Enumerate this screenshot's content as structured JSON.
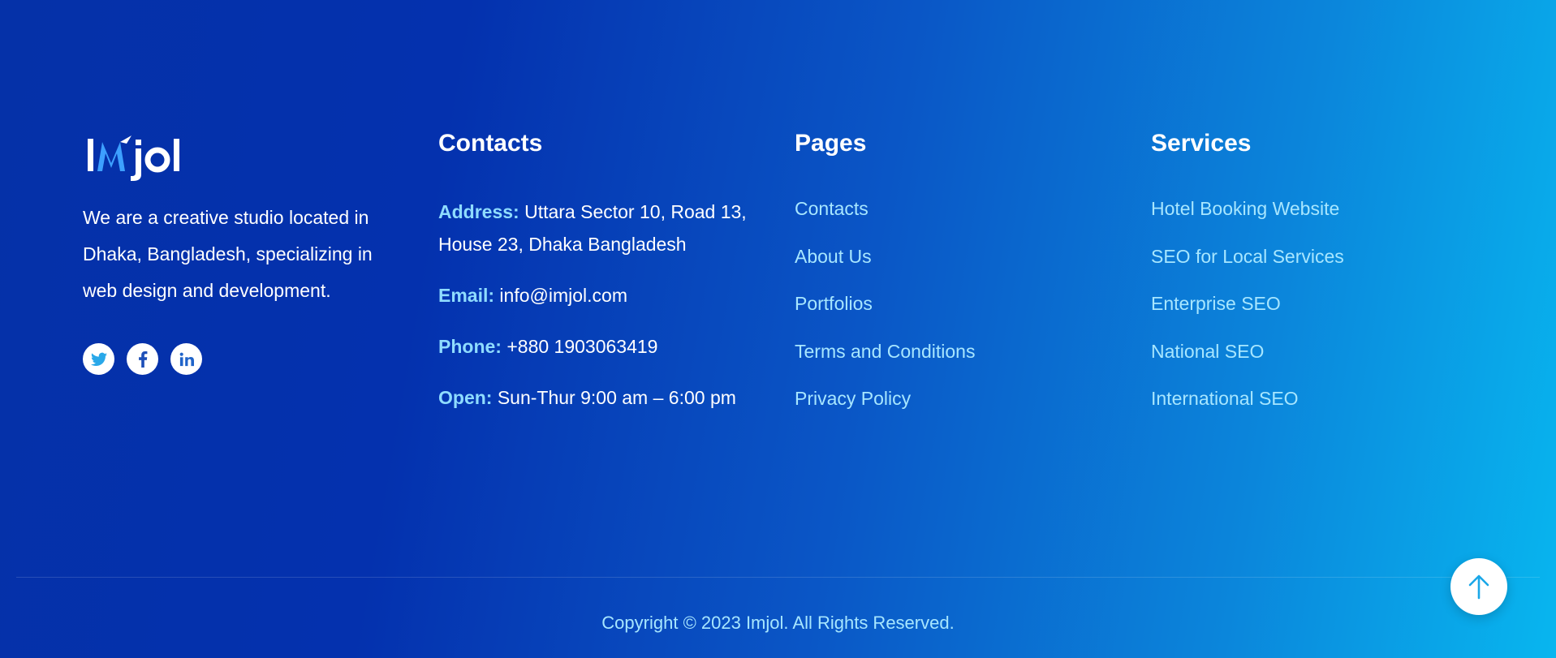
{
  "brand": {
    "logo_text": "Imjol",
    "description": "We are a creative studio located in Dhaka, Bangladesh, specializing in web design and development."
  },
  "social": [
    {
      "icon": "twitter-icon",
      "color": "#29a8e9"
    },
    {
      "icon": "facebook-icon",
      "color": "#1d4fb8"
    },
    {
      "icon": "linkedin-icon",
      "color": "#1f63c9"
    }
  ],
  "contacts": {
    "title": "Contacts",
    "address_label": "Address:",
    "address_value": "Uttara Sector 10, Road 13, House 23, Dhaka Bangladesh",
    "email_label": "Email:",
    "email_value": "info@imjol.com",
    "phone_label": "Phone:",
    "phone_value": "+880 1903063419",
    "open_label": "Open:",
    "open_value": "Sun-Thur 9:00 am – 6:00 pm"
  },
  "pages": {
    "title": "Pages",
    "items": [
      "Contacts",
      "About Us",
      "Portfolios",
      "Terms and Conditions",
      "Privacy Policy"
    ]
  },
  "services": {
    "title": "Services",
    "items": [
      "Hotel Booking Website",
      "SEO for Local Services",
      "Enterprise SEO",
      "National SEO",
      "International SEO"
    ]
  },
  "copyright": "Copyright © 2023 Imjol. All Rights Reserved.",
  "scroll_top": {
    "icon": "arrow-up-icon"
  },
  "colors": {
    "label_accent": "#8fdcff",
    "link": "#a7e6ff",
    "gradient_start": "#0531a8",
    "gradient_end": "#08b6ef",
    "logo_accent": "#1e90ff"
  }
}
